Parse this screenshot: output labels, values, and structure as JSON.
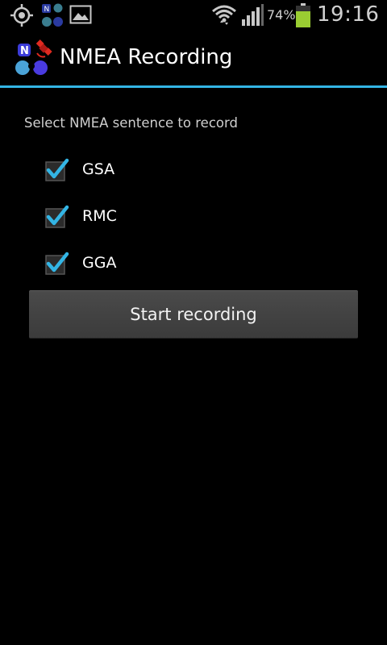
{
  "status_bar": {
    "battery_percent": "74%",
    "clock": "19:16",
    "icons": [
      "gps-icon",
      "app-notification-icon",
      "gallery-icon",
      "wifi-icon",
      "signal-icon",
      "battery-icon"
    ],
    "battery_color": "#9acd32"
  },
  "action_bar": {
    "title": "NMEA Recording",
    "accent_color": "#33b5e5"
  },
  "content": {
    "prompt": "Select NMEA sentence to record",
    "options": [
      {
        "label": "GSA",
        "checked": true
      },
      {
        "label": "RMC",
        "checked": true
      },
      {
        "label": "GGA",
        "checked": true
      }
    ],
    "start_button_label": "Start recording"
  }
}
